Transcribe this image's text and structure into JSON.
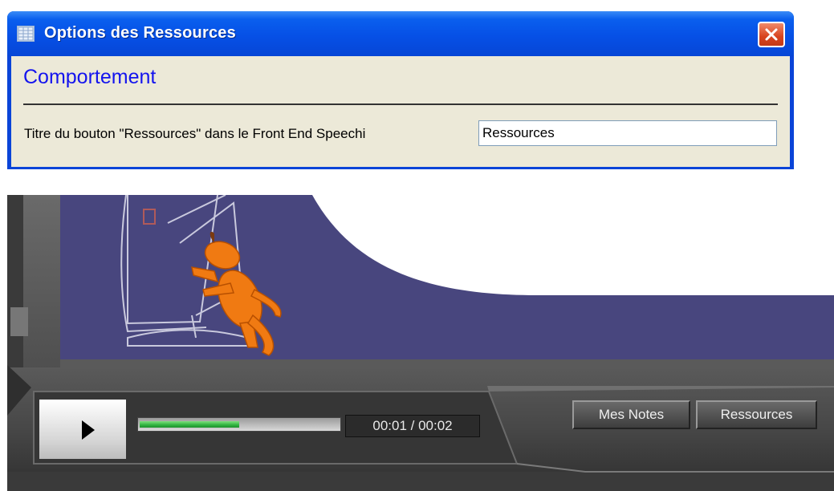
{
  "dialog": {
    "title": "Options des Ressources",
    "title_icon": "grid-window-icon",
    "close_icon": "close-icon",
    "section_title": "Comportement",
    "field_label": "Titre du bouton \"Ressources\" dans le Front End Speechi",
    "field_value": "Ressources"
  },
  "player": {
    "play_icon": "play-icon",
    "progress": 0.5,
    "time": "00:01 / 00:02",
    "notes_button": "Mes Notes",
    "resources_button": "Ressources"
  },
  "colors": {
    "titlebar": "#0a5fee",
    "section_title": "#1414ee",
    "scene_background": "#48467e",
    "progress_fill": "#2fb23f",
    "dog": "#f07a12"
  }
}
